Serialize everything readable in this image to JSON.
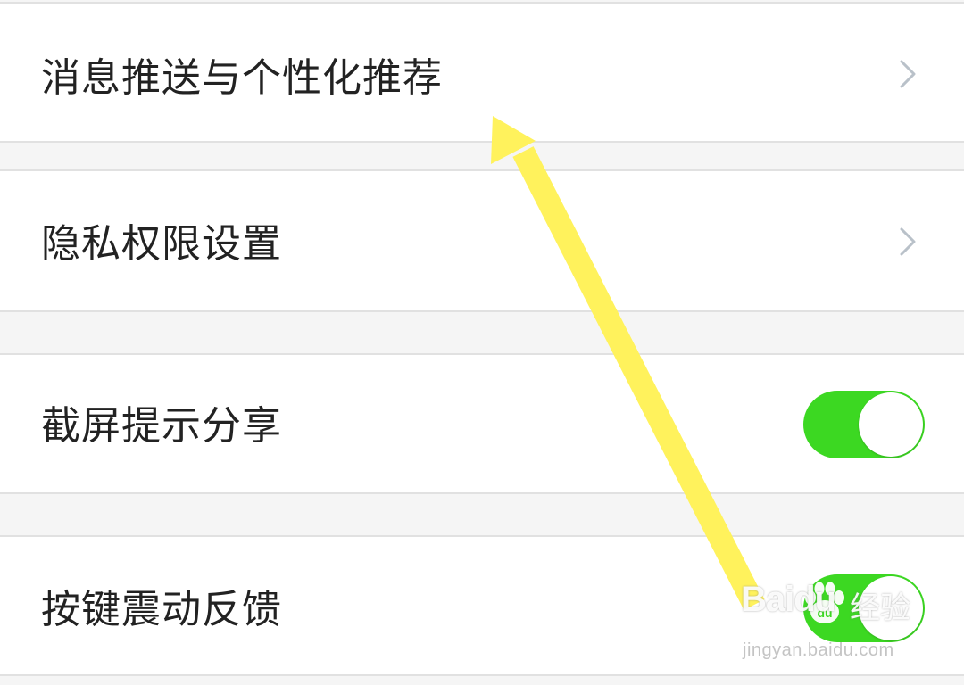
{
  "settings": {
    "items": [
      {
        "label": "消息推送与个性化推荐",
        "control": "chevron"
      },
      {
        "label": "隐私权限设置",
        "control": "chevron"
      },
      {
        "label": "截屏提示分享",
        "control": "toggle",
        "on": true
      },
      {
        "label": "按键震动反馈",
        "control": "toggle",
        "on": true
      }
    ]
  },
  "colors": {
    "toggle_on": "#3cd822",
    "annotation_arrow": "#fff25c",
    "chevron": "#b9c1c9"
  },
  "icons": {
    "chevron": "chevron-right-icon",
    "annotation": "arrow-annotation-icon"
  },
  "watermark": {
    "brand": "Baidu",
    "product": "经验",
    "url": "jingyan.baidu.com"
  }
}
